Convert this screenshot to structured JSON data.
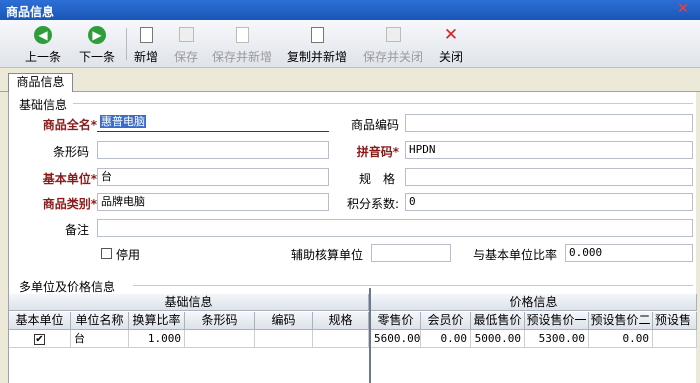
{
  "window": {
    "title": "商品信息",
    "close_glyph": "✕"
  },
  "toolbar": {
    "prev": "上一条",
    "next": "下一条",
    "new": "新增",
    "save": "保存",
    "save_new": "保存并新增",
    "copy_new": "复制并新增",
    "save_close": "保存并关闭",
    "close": "关闭"
  },
  "tabs": [
    "商品信息"
  ],
  "basic": {
    "section_title": "基础信息",
    "full_name_label": "商品全名*",
    "full_name_value": "惠普电脑",
    "code_label": "商品编码",
    "code_value": "",
    "barcode_label": "条形码",
    "barcode_value": "",
    "pinyin_label": "拼音码*",
    "pinyin_value": "HPDN",
    "unit_label": "基本单位*",
    "unit_value": "台",
    "spec_label": "规　格",
    "spec_value": "",
    "category_label": "商品类别*",
    "category_value": "品牌电脑",
    "points_label": "积分系数:",
    "points_value": "0",
    "remark_label": "备注",
    "remark_value": "",
    "disabled_label": "停用",
    "aux_unit_label": "辅助核算单位",
    "aux_unit_value": "",
    "ratio_label": "与基本单位比率",
    "ratio_value": "0.000"
  },
  "multi": {
    "section_title": "多单位及价格信息",
    "group_basic": "基础信息",
    "group_price": "价格信息",
    "columns": [
      "基本单位",
      "单位名称",
      "换算比率",
      "条形码",
      "编码",
      "规格",
      "零售价",
      "会员价",
      "最低售价",
      "预设售价一",
      "预设售价二",
      "预设售"
    ],
    "rows": [
      {
        "is_base": true,
        "unit_name": "台",
        "ratio": "1.000",
        "barcode": "",
        "code": "",
        "spec": "",
        "retail": "5600.00",
        "member": "0.00",
        "min_price": "5000.00",
        "preset1": "5300.00",
        "preset2": "0.00",
        "preset3": ""
      }
    ]
  },
  "colors": {
    "title_bar": "#1b56b8",
    "required_label": "#8b1a1a",
    "selection": "#3d6cc7"
  },
  "icons": [
    "arrow-left-icon",
    "arrow-right-icon",
    "new-doc-icon",
    "save-icon",
    "save-new-icon",
    "copy-new-icon",
    "save-close-icon",
    "close-x-icon"
  ]
}
